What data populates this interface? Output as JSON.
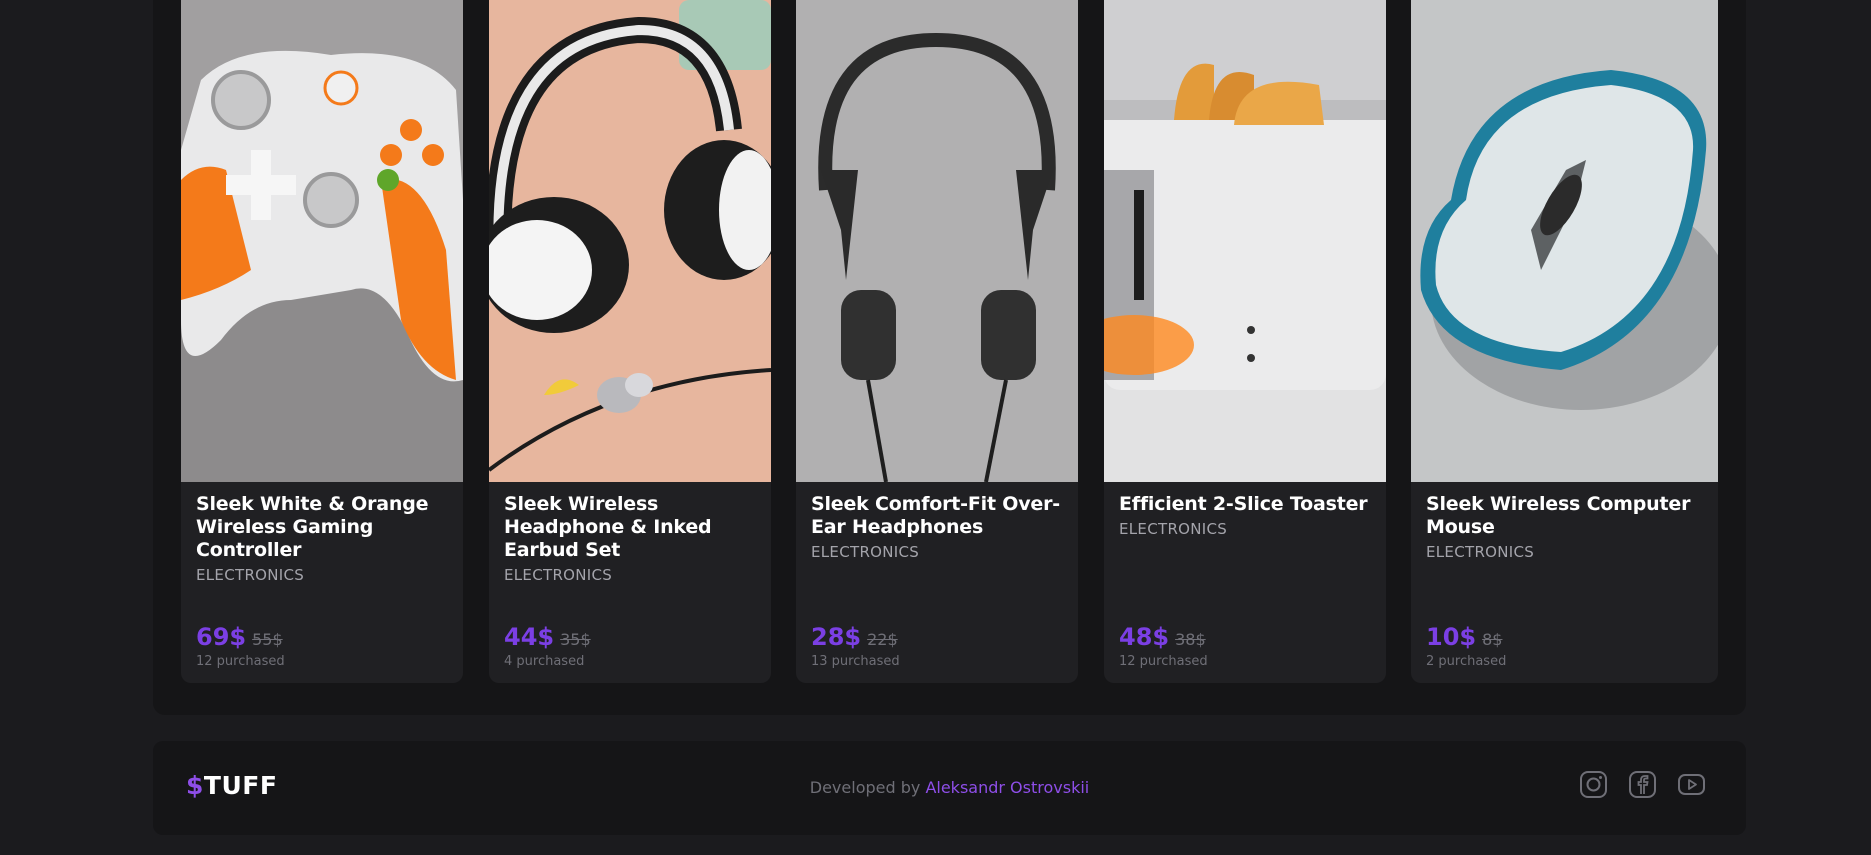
{
  "products": [
    {
      "title": "Sleek White & Orange Wireless Gaming Controller",
      "category": "ELECTRONICS",
      "price": "69$",
      "old_price": "55$",
      "purchased": "12 purchased"
    },
    {
      "title": "Sleek Wireless Headphone & Inked Earbud Set",
      "category": "ELECTRONICS",
      "price": "44$",
      "old_price": "35$",
      "purchased": "4 purchased"
    },
    {
      "title": "Sleek Comfort-Fit Over-Ear Headphones",
      "category": "ELECTRONICS",
      "price": "28$",
      "old_price": "22$",
      "purchased": "13 purchased"
    },
    {
      "title": "Efficient 2-Slice Toaster",
      "category": "ELECTRONICS",
      "price": "48$",
      "old_price": "38$",
      "purchased": "12 purchased"
    },
    {
      "title": "Sleek Wireless Computer Mouse",
      "category": "ELECTRONICS",
      "price": "10$",
      "old_price": "8$",
      "purchased": "2 purchased"
    }
  ],
  "footer": {
    "logo_symbol": "$",
    "logo_text": "TUFF",
    "credit_prefix": "Developed by",
    "credit_name": "Aleksandr Ostrovskii",
    "social": [
      "instagram-icon",
      "facebook-icon",
      "youtube-icon"
    ]
  },
  "colors": {
    "background": "#1b1b1e",
    "panel": "#151517",
    "card": "#202023",
    "accent": "#7b3fe4",
    "muted": "#6f6f77"
  }
}
